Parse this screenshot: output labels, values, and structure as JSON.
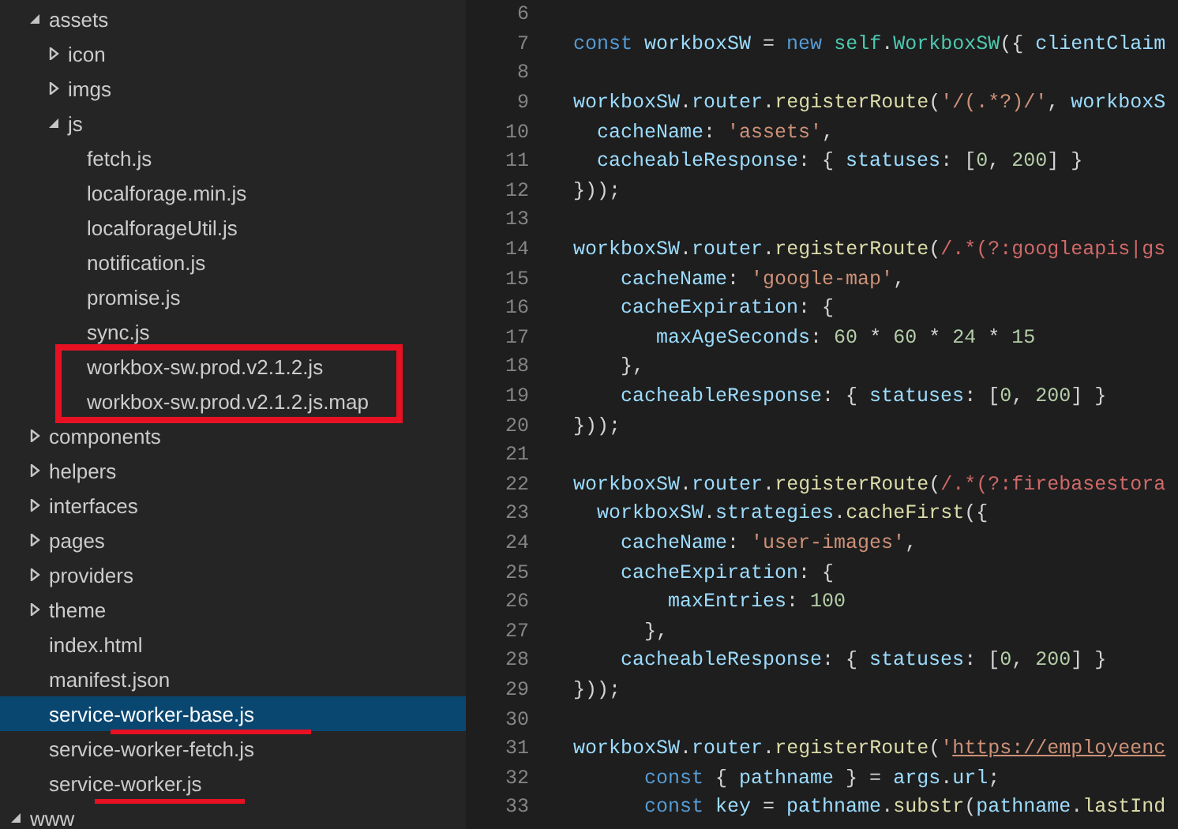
{
  "explorer": {
    "tree": [
      {
        "children": [
          {
            "label": "assets",
            "expanded": true,
            "selected": false,
            "children": [
              {
                "label": "icon",
                "expanded": false,
                "selected": false
              },
              {
                "label": "imgs",
                "expanded": false,
                "selected": false
              },
              {
                "label": "js",
                "expanded": true,
                "selected": false,
                "children": [
                  {
                    "label": "fetch.js",
                    "selected": false
                  },
                  {
                    "label": "localforage.min.js",
                    "selected": false
                  },
                  {
                    "label": "localforageUtil.js",
                    "selected": false
                  },
                  {
                    "label": "notification.js",
                    "selected": false
                  },
                  {
                    "label": "promise.js",
                    "selected": false
                  },
                  {
                    "label": "sync.js",
                    "selected": false
                  },
                  {
                    "label": "workbox-sw.prod.v2.1.2.js",
                    "selected": false,
                    "boxed": true
                  },
                  {
                    "label": "workbox-sw.prod.v2.1.2.js.map",
                    "selected": false,
                    "boxed": true
                  }
                ]
              }
            ]
          },
          {
            "label": "components",
            "expanded": false,
            "selected": false
          },
          {
            "label": "helpers",
            "expanded": false,
            "selected": false
          },
          {
            "label": "interfaces",
            "expanded": false,
            "selected": false
          },
          {
            "label": "pages",
            "expanded": false,
            "selected": false
          },
          {
            "label": "providers",
            "expanded": false,
            "selected": false
          },
          {
            "label": "theme",
            "expanded": false,
            "selected": false
          },
          {
            "label": "index.html",
            "selected": false
          },
          {
            "label": "manifest.json",
            "selected": false
          },
          {
            "label": "service-worker-base.js",
            "selected": true,
            "underlined": true
          },
          {
            "label": "service-worker-fetch.js",
            "selected": false
          },
          {
            "label": "service-worker.js",
            "selected": false,
            "underlined": true
          }
        ]
      },
      {
        "label": "www",
        "expanded": true,
        "selected": false
      }
    ]
  },
  "editor": {
    "lines": [
      {
        "number": "6"
      },
      {
        "number": "7",
        "tokens": [
          {
            "text": "const",
            "kind": "keyword"
          },
          {
            "text": " workboxSW",
            "kind": "variable"
          },
          {
            "text": " = ",
            "kind": "plain"
          },
          {
            "text": "new",
            "kind": "keyword"
          },
          {
            "text": " self",
            "kind": "class"
          },
          {
            "text": ".",
            "kind": "plain"
          },
          {
            "text": "WorkboxSW",
            "kind": "class"
          },
          {
            "text": "({ ",
            "kind": "plain"
          },
          {
            "text": "clientClaim",
            "kind": "variable"
          }
        ]
      },
      {
        "number": "8"
      },
      {
        "number": "9",
        "tokens": [
          {
            "text": "workboxSW",
            "kind": "variable"
          },
          {
            "text": ".",
            "kind": "plain"
          },
          {
            "text": "router",
            "kind": "variable"
          },
          {
            "text": ".",
            "kind": "plain"
          },
          {
            "text": "registerRoute",
            "kind": "function"
          },
          {
            "text": "(",
            "kind": "plain"
          },
          {
            "text": "'/(.*?)/'",
            "kind": "string"
          },
          {
            "text": ", ",
            "kind": "plain"
          },
          {
            "text": "workboxS",
            "kind": "variable"
          }
        ]
      },
      {
        "number": "10",
        "tokens": [
          {
            "text": "  cacheName",
            "kind": "variable"
          },
          {
            "text": ": ",
            "kind": "plain"
          },
          {
            "text": "'assets'",
            "kind": "string"
          },
          {
            "text": ",",
            "kind": "plain"
          }
        ]
      },
      {
        "number": "11",
        "tokens": [
          {
            "text": "  cacheableResponse",
            "kind": "variable"
          },
          {
            "text": ": { ",
            "kind": "plain"
          },
          {
            "text": "statuses",
            "kind": "variable"
          },
          {
            "text": ": [",
            "kind": "plain"
          },
          {
            "text": "0",
            "kind": "number"
          },
          {
            "text": ", ",
            "kind": "plain"
          },
          {
            "text": "200",
            "kind": "number"
          },
          {
            "text": "] }",
            "kind": "plain"
          }
        ]
      },
      {
        "number": "12",
        "tokens": [
          {
            "text": "}));",
            "kind": "plain"
          }
        ]
      },
      {
        "number": "13"
      },
      {
        "number": "14",
        "tokens": [
          {
            "text": "workboxSW",
            "kind": "variable"
          },
          {
            "text": ".",
            "kind": "plain"
          },
          {
            "text": "router",
            "kind": "variable"
          },
          {
            "text": ".",
            "kind": "plain"
          },
          {
            "text": "registerRoute",
            "kind": "function"
          },
          {
            "text": "(",
            "kind": "plain"
          },
          {
            "text": "/.*(?:googleapis|gs",
            "kind": "regex"
          }
        ]
      },
      {
        "number": "15",
        "tokens": [
          {
            "text": "    cacheName",
            "kind": "variable"
          },
          {
            "text": ": ",
            "kind": "plain"
          },
          {
            "text": "'google-map'",
            "kind": "string"
          },
          {
            "text": ",",
            "kind": "plain"
          }
        ]
      },
      {
        "number": "16",
        "tokens": [
          {
            "text": "    cacheExpiration",
            "kind": "variable"
          },
          {
            "text": ": {",
            "kind": "plain"
          }
        ]
      },
      {
        "number": "17",
        "tokens": [
          {
            "text": "       maxAgeSeconds",
            "kind": "variable"
          },
          {
            "text": ": ",
            "kind": "plain"
          },
          {
            "text": "60",
            "kind": "number"
          },
          {
            "text": " * ",
            "kind": "plain"
          },
          {
            "text": "60",
            "kind": "number"
          },
          {
            "text": " * ",
            "kind": "plain"
          },
          {
            "text": "24",
            "kind": "number"
          },
          {
            "text": " * ",
            "kind": "plain"
          },
          {
            "text": "15",
            "kind": "number"
          }
        ]
      },
      {
        "number": "18",
        "tokens": [
          {
            "text": "    },",
            "kind": "plain"
          }
        ]
      },
      {
        "number": "19",
        "tokens": [
          {
            "text": "    cacheableResponse",
            "kind": "variable"
          },
          {
            "text": ": { ",
            "kind": "plain"
          },
          {
            "text": "statuses",
            "kind": "variable"
          },
          {
            "text": ": [",
            "kind": "plain"
          },
          {
            "text": "0",
            "kind": "number"
          },
          {
            "text": ", ",
            "kind": "plain"
          },
          {
            "text": "200",
            "kind": "number"
          },
          {
            "text": "] }",
            "kind": "plain"
          }
        ]
      },
      {
        "number": "20",
        "tokens": [
          {
            "text": "}));",
            "kind": "plain"
          }
        ]
      },
      {
        "number": "21"
      },
      {
        "number": "22",
        "tokens": [
          {
            "text": "workboxSW",
            "kind": "variable"
          },
          {
            "text": ".",
            "kind": "plain"
          },
          {
            "text": "router",
            "kind": "variable"
          },
          {
            "text": ".",
            "kind": "plain"
          },
          {
            "text": "registerRoute",
            "kind": "function"
          },
          {
            "text": "(",
            "kind": "plain"
          },
          {
            "text": "/.*(?:firebasestora",
            "kind": "regex"
          }
        ]
      },
      {
        "number": "23",
        "tokens": [
          {
            "text": "  workboxSW",
            "kind": "variable"
          },
          {
            "text": ".",
            "kind": "plain"
          },
          {
            "text": "strategies",
            "kind": "variable"
          },
          {
            "text": ".",
            "kind": "plain"
          },
          {
            "text": "cacheFirst",
            "kind": "function"
          },
          {
            "text": "({",
            "kind": "plain"
          }
        ]
      },
      {
        "number": "24",
        "tokens": [
          {
            "text": "    cacheName",
            "kind": "variable"
          },
          {
            "text": ": ",
            "kind": "plain"
          },
          {
            "text": "'user-images'",
            "kind": "string"
          },
          {
            "text": ",",
            "kind": "plain"
          }
        ]
      },
      {
        "number": "25",
        "tokens": [
          {
            "text": "    cacheExpiration",
            "kind": "variable"
          },
          {
            "text": ": {",
            "kind": "plain"
          }
        ]
      },
      {
        "number": "26",
        "tokens": [
          {
            "text": "        maxEntries",
            "kind": "variable"
          },
          {
            "text": ": ",
            "kind": "plain"
          },
          {
            "text": "100",
            "kind": "number"
          }
        ]
      },
      {
        "number": "27",
        "tokens": [
          {
            "text": "      },",
            "kind": "plain"
          }
        ]
      },
      {
        "number": "28",
        "tokens": [
          {
            "text": "    cacheableResponse",
            "kind": "variable"
          },
          {
            "text": ": { ",
            "kind": "plain"
          },
          {
            "text": "statuses",
            "kind": "variable"
          },
          {
            "text": ": [",
            "kind": "plain"
          },
          {
            "text": "0",
            "kind": "number"
          },
          {
            "text": ", ",
            "kind": "plain"
          },
          {
            "text": "200",
            "kind": "number"
          },
          {
            "text": "] }",
            "kind": "plain"
          }
        ]
      },
      {
        "number": "29",
        "tokens": [
          {
            "text": "}));",
            "kind": "plain"
          }
        ]
      },
      {
        "number": "30"
      },
      {
        "number": "31",
        "tokens": [
          {
            "text": "workboxSW",
            "kind": "variable"
          },
          {
            "text": ".",
            "kind": "plain"
          },
          {
            "text": "router",
            "kind": "variable"
          },
          {
            "text": ".",
            "kind": "plain"
          },
          {
            "text": "registerRoute",
            "kind": "function"
          },
          {
            "text": "(",
            "kind": "plain"
          },
          {
            "text": "'",
            "kind": "string"
          },
          {
            "text": "https://employeenc",
            "kind": "link"
          }
        ]
      },
      {
        "number": "32",
        "tokens": [
          {
            "text": "      const",
            "kind": "keyword"
          },
          {
            "text": " { ",
            "kind": "plain"
          },
          {
            "text": "pathname",
            "kind": "variable"
          },
          {
            "text": " } = ",
            "kind": "plain"
          },
          {
            "text": "args",
            "kind": "variable"
          },
          {
            "text": ".",
            "kind": "plain"
          },
          {
            "text": "url",
            "kind": "variable"
          },
          {
            "text": ";",
            "kind": "plain"
          }
        ]
      },
      {
        "number": "33",
        "tokens": [
          {
            "text": "      const",
            "kind": "keyword"
          },
          {
            "text": " key",
            "kind": "variable"
          },
          {
            "text": " = ",
            "kind": "plain"
          },
          {
            "text": "pathname",
            "kind": "variable"
          },
          {
            "text": ".",
            "kind": "plain"
          },
          {
            "text": "substr",
            "kind": "function"
          },
          {
            "text": "(",
            "kind": "plain"
          },
          {
            "text": "pathname",
            "kind": "variable"
          },
          {
            "text": ".",
            "kind": "plain"
          },
          {
            "text": "lastInd",
            "kind": "function"
          }
        ]
      }
    ]
  }
}
